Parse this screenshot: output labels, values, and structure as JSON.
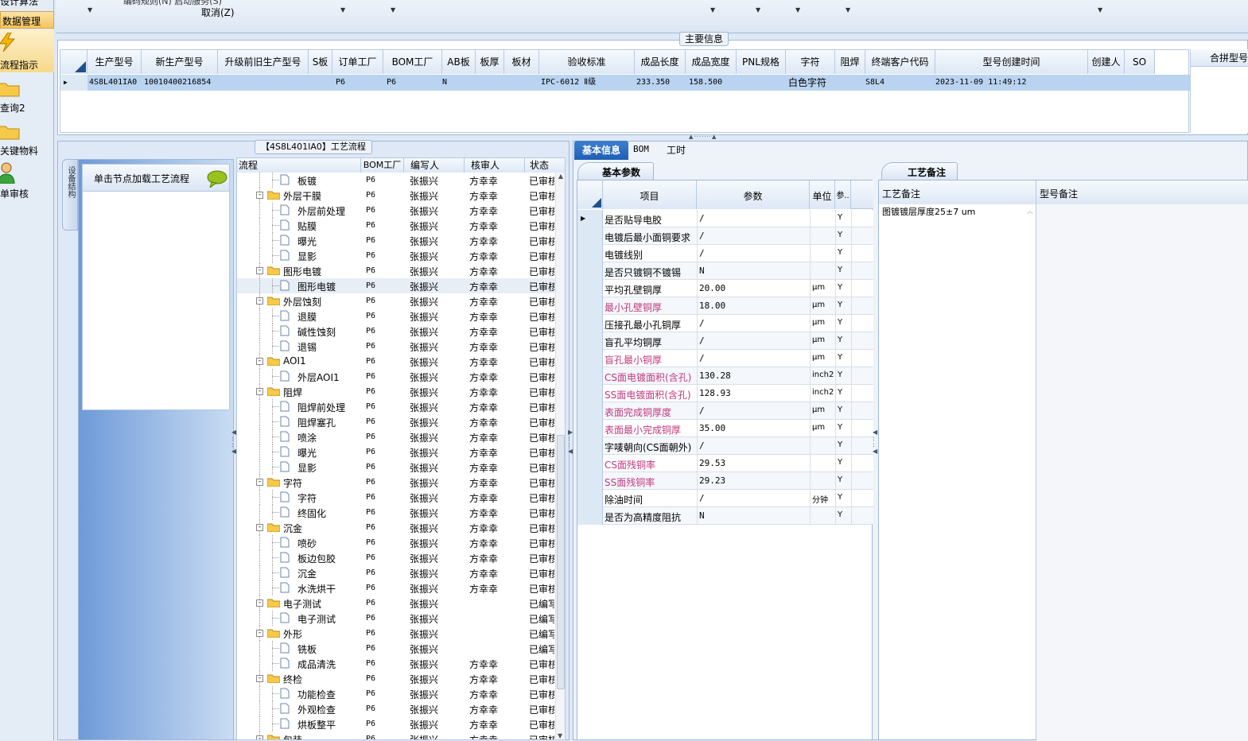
{
  "top_menu": {
    "line1": "编码规则(N)    启动服务(S)",
    "cancel_label": "取消(Z)",
    "top_left_cut": "设计算法"
  },
  "sidebar": {
    "items": [
      {
        "label": "数据管理",
        "icon": "none"
      },
      {
        "label": "流程指示",
        "icon": "lightning-icon"
      },
      {
        "label": "查询2",
        "icon": "folder-icon"
      },
      {
        "label": "关键物料",
        "icon": "folder-icon"
      },
      {
        "label": "单审核",
        "icon": "user-icon"
      }
    ]
  },
  "main_info": {
    "section_title": "主要信息",
    "columns": [
      "生产型号",
      "新生产型号",
      "升级前旧生产型号",
      "S板",
      "订单工厂",
      "BOM工厂",
      "AB板",
      "板厚",
      "板材",
      "验收标准",
      "成品长度",
      "成品宽度",
      "PNL规格",
      "字符",
      "阻焊",
      "终端客户代码",
      "型号创建时间",
      "创建人",
      "SO"
    ],
    "row": [
      "4S8L401IA0",
      "10010400216854",
      "",
      "",
      "P6",
      "P6",
      "N",
      "",
      "",
      "IPC-6012 Ⅱ级",
      "233.350",
      "158.500",
      "",
      "白色字符",
      "",
      "S8L4",
      "2023-11-09 11:49:12",
      "",
      ""
    ],
    "merge_label": "合拼型号"
  },
  "process": {
    "panel_title": "【4S8L401IA0】工艺流程",
    "left_tab": "设备结构",
    "load_hint": "单击节点加载工艺流程",
    "columns": [
      "流程",
      "BOM工厂",
      "编写人",
      "核审人",
      "状态"
    ],
    "rows": [
      {
        "name": "板镀",
        "level": 2,
        "bom": "P6",
        "writer": "张振兴",
        "reviewer": "方幸幸",
        "status": "已审核"
      },
      {
        "name": "外层干膜",
        "level": 1,
        "bom": "P6",
        "writer": "张振兴",
        "reviewer": "方幸幸",
        "status": "已审核"
      },
      {
        "name": "外层前处理",
        "level": 2,
        "bom": "P6",
        "writer": "张振兴",
        "reviewer": "方幸幸",
        "status": "已审核"
      },
      {
        "name": "贴膜",
        "level": 2,
        "bom": "P6",
        "writer": "张振兴",
        "reviewer": "方幸幸",
        "status": "已审核"
      },
      {
        "name": "曝光",
        "level": 2,
        "bom": "P6",
        "writer": "张振兴",
        "reviewer": "方幸幸",
        "status": "已审核"
      },
      {
        "name": "显影",
        "level": 2,
        "bom": "P6",
        "writer": "张振兴",
        "reviewer": "方幸幸",
        "status": "已审核"
      },
      {
        "name": "图形电镀",
        "level": 1,
        "bom": "P6",
        "writer": "张振兴",
        "reviewer": "方幸幸",
        "status": "已审核"
      },
      {
        "name": "图形电镀",
        "level": 2,
        "bom": "P6",
        "writer": "张振兴",
        "reviewer": "方幸幸",
        "status": "已审核",
        "selected": true
      },
      {
        "name": "外层蚀刻",
        "level": 1,
        "bom": "P6",
        "writer": "张振兴",
        "reviewer": "方幸幸",
        "status": "已审核"
      },
      {
        "name": "退膜",
        "level": 2,
        "bom": "P6",
        "writer": "张振兴",
        "reviewer": "方幸幸",
        "status": "已审核"
      },
      {
        "name": "碱性蚀刻",
        "level": 2,
        "bom": "P6",
        "writer": "张振兴",
        "reviewer": "方幸幸",
        "status": "已审核"
      },
      {
        "name": "退锡",
        "level": 2,
        "bom": "P6",
        "writer": "张振兴",
        "reviewer": "方幸幸",
        "status": "已审核"
      },
      {
        "name": "AOI1",
        "level": 1,
        "bom": "P6",
        "writer": "张振兴",
        "reviewer": "方幸幸",
        "status": "已审核"
      },
      {
        "name": "外层AOI1",
        "level": 2,
        "bom": "P6",
        "writer": "张振兴",
        "reviewer": "方幸幸",
        "status": "已审核"
      },
      {
        "name": "阻焊",
        "level": 1,
        "bom": "P6",
        "writer": "张振兴",
        "reviewer": "方幸幸",
        "status": "已审核"
      },
      {
        "name": "阻焊前处理",
        "level": 2,
        "bom": "P6",
        "writer": "张振兴",
        "reviewer": "方幸幸",
        "status": "已审核"
      },
      {
        "name": "阻焊塞孔",
        "level": 2,
        "bom": "P6",
        "writer": "张振兴",
        "reviewer": "方幸幸",
        "status": "已审核"
      },
      {
        "name": "喷涂",
        "level": 2,
        "bom": "P6",
        "writer": "张振兴",
        "reviewer": "方幸幸",
        "status": "已审核"
      },
      {
        "name": "曝光",
        "level": 2,
        "bom": "P6",
        "writer": "张振兴",
        "reviewer": "方幸幸",
        "status": "已审核"
      },
      {
        "name": "显影",
        "level": 2,
        "bom": "P6",
        "writer": "张振兴",
        "reviewer": "方幸幸",
        "status": "已审核"
      },
      {
        "name": "字符",
        "level": 1,
        "bom": "P6",
        "writer": "张振兴",
        "reviewer": "方幸幸",
        "status": "已审核"
      },
      {
        "name": "字符",
        "level": 2,
        "bom": "P6",
        "writer": "张振兴",
        "reviewer": "方幸幸",
        "status": "已审核"
      },
      {
        "name": "终固化",
        "level": 2,
        "bom": "P6",
        "writer": "张振兴",
        "reviewer": "方幸幸",
        "status": "已审核"
      },
      {
        "name": "沉金",
        "level": 1,
        "bom": "P6",
        "writer": "张振兴",
        "reviewer": "方幸幸",
        "status": "已审核"
      },
      {
        "name": "喷砂",
        "level": 2,
        "bom": "P6",
        "writer": "张振兴",
        "reviewer": "方幸幸",
        "status": "已审核"
      },
      {
        "name": "板边包胶",
        "level": 2,
        "bom": "P6",
        "writer": "张振兴",
        "reviewer": "方幸幸",
        "status": "已审核"
      },
      {
        "name": "沉金",
        "level": 2,
        "bom": "P6",
        "writer": "张振兴",
        "reviewer": "方幸幸",
        "status": "已审核"
      },
      {
        "name": "水洗烘干",
        "level": 2,
        "bom": "P6",
        "writer": "张振兴",
        "reviewer": "方幸幸",
        "status": "已审核"
      },
      {
        "name": "电子测试",
        "level": 1,
        "bom": "P6",
        "writer": "张振兴",
        "reviewer": "",
        "status": "已编写"
      },
      {
        "name": "电子测试",
        "level": 2,
        "bom": "P6",
        "writer": "张振兴",
        "reviewer": "",
        "status": "已编写"
      },
      {
        "name": "外形",
        "level": 1,
        "bom": "P6",
        "writer": "张振兴",
        "reviewer": "",
        "status": "已编写"
      },
      {
        "name": "铣板",
        "level": 2,
        "bom": "P6",
        "writer": "张振兴",
        "reviewer": "",
        "status": "已编写"
      },
      {
        "name": "成品清洗",
        "level": 2,
        "bom": "P6",
        "writer": "张振兴",
        "reviewer": "方幸幸",
        "status": "已审核"
      },
      {
        "name": "终检",
        "level": 1,
        "bom": "P6",
        "writer": "张振兴",
        "reviewer": "方幸幸",
        "status": "已审核"
      },
      {
        "name": "功能检查",
        "level": 2,
        "bom": "P6",
        "writer": "张振兴",
        "reviewer": "方幸幸",
        "status": "已审核"
      },
      {
        "name": "外观检查",
        "level": 2,
        "bom": "P6",
        "writer": "张振兴",
        "reviewer": "方幸幸",
        "status": "已审核"
      },
      {
        "name": "烘板整平",
        "level": 2,
        "bom": "P6",
        "writer": "张振兴",
        "reviewer": "方幸幸",
        "status": "已审核"
      },
      {
        "name": "包装",
        "level": 1,
        "bom": "P6",
        "writer": "张振兴",
        "reviewer": "方幸幸",
        "status": "已审核"
      }
    ]
  },
  "tabs": [
    "基本信息",
    "BOM",
    "工时"
  ],
  "params": {
    "subtab": "基本参数",
    "columns": [
      "项目",
      "参数",
      "单位",
      "参.."
    ],
    "rows": [
      {
        "item": "是否贴导电胶",
        "value": "/",
        "unit": "",
        "flag": "Y",
        "pink": false
      },
      {
        "item": "电镀后最小面铜要求",
        "value": "/",
        "unit": "",
        "flag": "Y",
        "pink": false
      },
      {
        "item": "电镀线别",
        "value": "/",
        "unit": "",
        "flag": "Y",
        "pink": false
      },
      {
        "item": "是否只镀铜不镀锡",
        "value": "N",
        "unit": "",
        "flag": "Y",
        "pink": false
      },
      {
        "item": "平均孔壁铜厚",
        "value": "20.00",
        "unit": "μm",
        "flag": "Y",
        "pink": false
      },
      {
        "item": "最小孔壁铜厚",
        "value": "18.00",
        "unit": "μm",
        "flag": "Y",
        "pink": true
      },
      {
        "item": "压接孔最小孔铜厚",
        "value": "/",
        "unit": "μm",
        "flag": "Y",
        "pink": false
      },
      {
        "item": "盲孔平均铜厚",
        "value": "/",
        "unit": "μm",
        "flag": "Y",
        "pink": false
      },
      {
        "item": "盲孔最小铜厚",
        "value": "/",
        "unit": "μm",
        "flag": "Y",
        "pink": true
      },
      {
        "item": "CS面电镀面积(含孔)",
        "value": "130.28",
        "unit": "inch2",
        "flag": "Y",
        "pink": true
      },
      {
        "item": "SS面电镀面积(含孔)",
        "value": "128.93",
        "unit": "inch2",
        "flag": "Y",
        "pink": true
      },
      {
        "item": "表面完成铜厚度",
        "value": "/",
        "unit": "μm",
        "flag": "Y",
        "pink": true
      },
      {
        "item": "表面最小完成铜厚",
        "value": "35.00",
        "unit": "μm",
        "flag": "Y",
        "pink": true
      },
      {
        "item": "字唛朝向(CS面朝外)",
        "value": "/",
        "unit": "",
        "flag": "Y",
        "pink": false
      },
      {
        "item": "CS面残铜率",
        "value": "29.53",
        "unit": "",
        "flag": "Y",
        "pink": true
      },
      {
        "item": "SS面残铜率",
        "value": "29.23",
        "unit": "",
        "flag": "Y",
        "pink": true
      },
      {
        "item": "除油时间",
        "value": "/",
        "unit": "分钟",
        "flag": "Y",
        "pink": false
      },
      {
        "item": "是否为高精度阻抗",
        "value": "N",
        "unit": "",
        "flag": "Y",
        "pink": false
      }
    ]
  },
  "notes": {
    "subtab": "工艺备注",
    "col_process": "工艺备注",
    "col_model": "型号备注",
    "process_note": "图镀镀层厚度25±7 um"
  },
  "colors": {
    "accent": "#1e5fb4",
    "pink": "#c0397f",
    "header_bg": "#dde8f5",
    "selected_row": "#b9d3f0"
  }
}
